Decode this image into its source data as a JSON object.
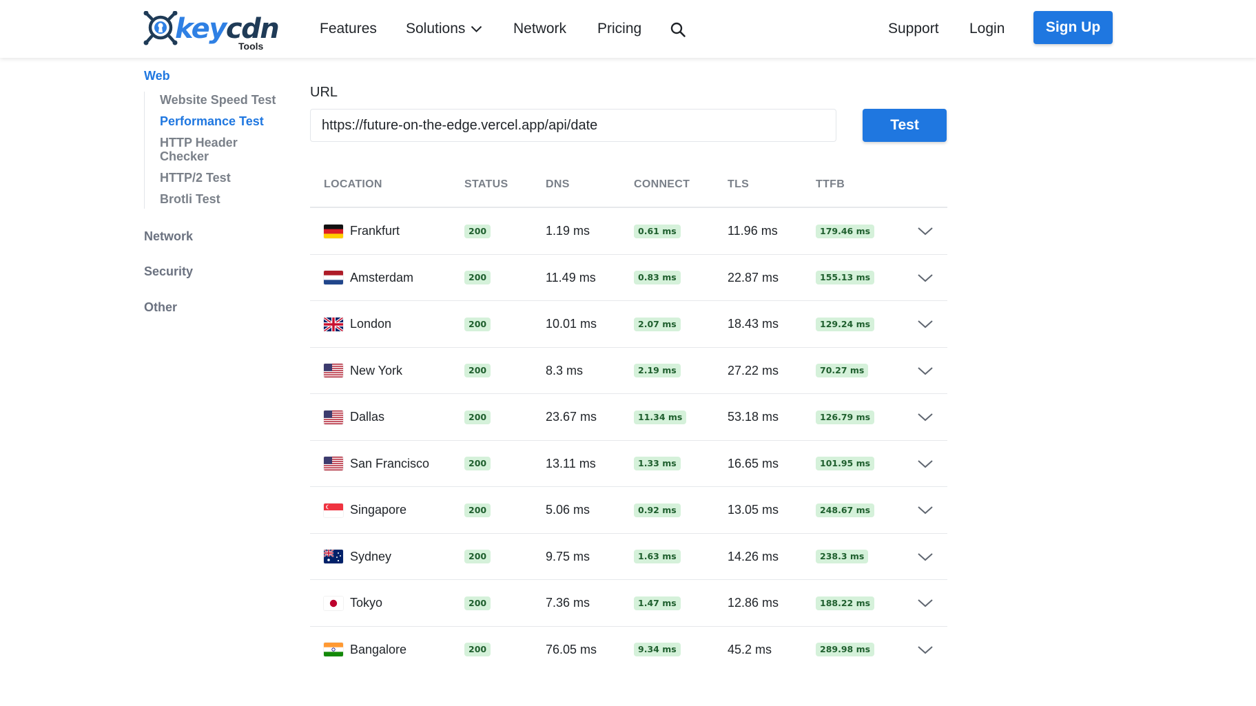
{
  "brand": {
    "name_part1": "key",
    "name_part2": "cdn",
    "sub": "Tools"
  },
  "nav": {
    "features": "Features",
    "solutions": "Solutions",
    "network": "Network",
    "pricing": "Pricing",
    "support": "Support",
    "login": "Login",
    "signup": "Sign Up"
  },
  "sidebar": {
    "web": "Web",
    "web_items": [
      "Website Speed Test",
      "Performance Test",
      "HTTP Header Checker",
      "HTTP/2 Test",
      "Brotli Test"
    ],
    "active_item": "Performance Test",
    "network": "Network",
    "security": "Security",
    "other": "Other"
  },
  "form": {
    "url_label": "URL",
    "url_value": "https://future-on-the-edge.vercel.app/api/date",
    "test_label": "Test"
  },
  "table": {
    "headers": {
      "location": "LOCATION",
      "status": "STATUS",
      "dns": "DNS",
      "connect": "CONNECT",
      "tls": "TLS",
      "ttfb": "TTFB"
    },
    "rows": [
      {
        "flag": "germany",
        "location": "Frankfurt",
        "status": "200",
        "dns": "1.19 ms",
        "connect": "0.61 ms",
        "tls": "11.96 ms",
        "ttfb": "179.46 ms"
      },
      {
        "flag": "netherlands",
        "location": "Amsterdam",
        "status": "200",
        "dns": "11.49 ms",
        "connect": "0.83 ms",
        "tls": "22.87 ms",
        "ttfb": "155.13 ms"
      },
      {
        "flag": "uk",
        "location": "London",
        "status": "200",
        "dns": "10.01 ms",
        "connect": "2.07 ms",
        "tls": "18.43 ms",
        "ttfb": "129.24 ms"
      },
      {
        "flag": "usa",
        "location": "New York",
        "status": "200",
        "dns": "8.3 ms",
        "connect": "2.19 ms",
        "tls": "27.22 ms",
        "ttfb": "70.27 ms"
      },
      {
        "flag": "usa",
        "location": "Dallas",
        "status": "200",
        "dns": "23.67 ms",
        "connect": "11.34 ms",
        "tls": "53.18 ms",
        "ttfb": "126.79 ms"
      },
      {
        "flag": "usa",
        "location": "San Francisco",
        "status": "200",
        "dns": "13.11 ms",
        "connect": "1.33 ms",
        "tls": "16.65 ms",
        "ttfb": "101.95 ms"
      },
      {
        "flag": "singapore",
        "location": "Singapore",
        "status": "200",
        "dns": "5.06 ms",
        "connect": "0.92 ms",
        "tls": "13.05 ms",
        "ttfb": "248.67 ms"
      },
      {
        "flag": "australia",
        "location": "Sydney",
        "status": "200",
        "dns": "9.75 ms",
        "connect": "1.63 ms",
        "tls": "14.26 ms",
        "ttfb": "238.3 ms"
      },
      {
        "flag": "japan",
        "location": "Tokyo",
        "status": "200",
        "dns": "7.36 ms",
        "connect": "1.47 ms",
        "tls": "12.86 ms",
        "ttfb": "188.22 ms"
      },
      {
        "flag": "india",
        "location": "Bangalore",
        "status": "200",
        "dns": "76.05 ms",
        "connect": "9.34 ms",
        "tls": "45.2 ms",
        "ttfb": "289.98 ms"
      }
    ]
  },
  "colors": {
    "accent": "#1f77e0",
    "badge_bg": "#d5f1da",
    "badge_text": "#1f5f2e",
    "muted": "#7a8089"
  }
}
